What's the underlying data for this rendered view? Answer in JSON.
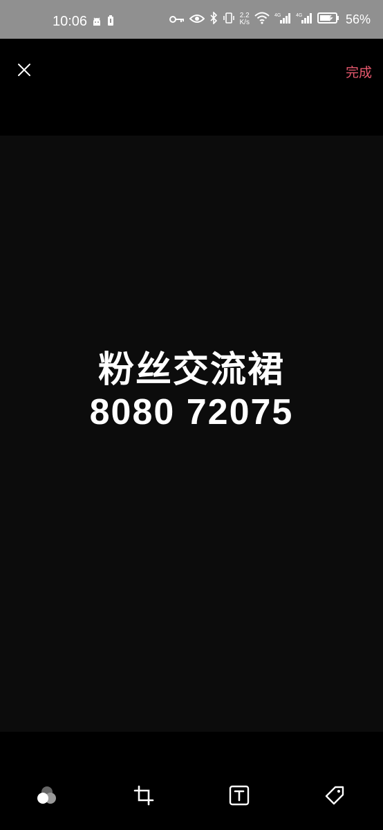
{
  "status_bar": {
    "time": "10:06",
    "net_speed_value": "2.2",
    "net_speed_unit": "K/s",
    "battery_percent": "56%",
    "icons": [
      "android-debug-icon",
      "battery-saver-icon",
      "vpn-key-icon",
      "eye-comfort-icon",
      "bluetooth-icon",
      "vibrate-icon",
      "wifi-icon",
      "signal-4g-icon",
      "signal-4g-icon",
      "battery-icon"
    ]
  },
  "top_toolbar": {
    "close_icon": "close-icon",
    "done_label": "完成",
    "accent_color": "#e8596e"
  },
  "image": {
    "line1": "粉丝交流裙",
    "line2": "8080 72075"
  },
  "bottom_toolbar": {
    "tools": [
      "filter-icon",
      "crop-icon",
      "text-icon",
      "tag-icon"
    ]
  }
}
